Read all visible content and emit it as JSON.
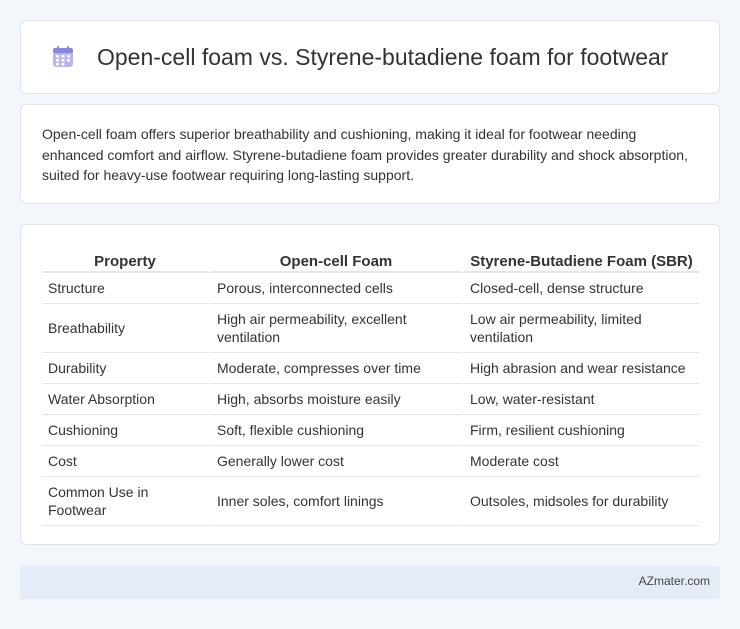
{
  "header": {
    "title": "Open-cell foam vs. Styrene-butadiene foam for footwear",
    "icon": "calendar-grid-icon",
    "icon_color": "#8a86d6"
  },
  "summary": {
    "text": "Open-cell foam offers superior breathability and cushioning, making it ideal for footwear needing enhanced comfort and airflow. Styrene-butadiene foam provides greater durability and shock absorption, suited for heavy-use footwear requiring long-lasting support."
  },
  "table": {
    "headers": [
      "Property",
      "Open-cell Foam",
      "Styrene-Butadiene Foam (SBR)"
    ],
    "rows": [
      [
        "Structure",
        "Porous, interconnected cells",
        "Closed-cell, dense structure"
      ],
      [
        "Breathability",
        "High air permeability, excellent ventilation",
        "Low air permeability, limited ventilation"
      ],
      [
        "Durability",
        "Moderate, compresses over time",
        "High abrasion and wear resistance"
      ],
      [
        "Water Absorption",
        "High, absorbs moisture easily",
        "Low, water-resistant"
      ],
      [
        "Cushioning",
        "Soft, flexible cushioning",
        "Firm, resilient cushioning"
      ],
      [
        "Cost",
        "Generally lower cost",
        "Moderate cost"
      ],
      [
        "Common Use in Footwear",
        "Inner soles, comfort linings",
        "Outsoles, midsoles for durability"
      ]
    ]
  },
  "footer": {
    "brand": "AZmater.com"
  }
}
